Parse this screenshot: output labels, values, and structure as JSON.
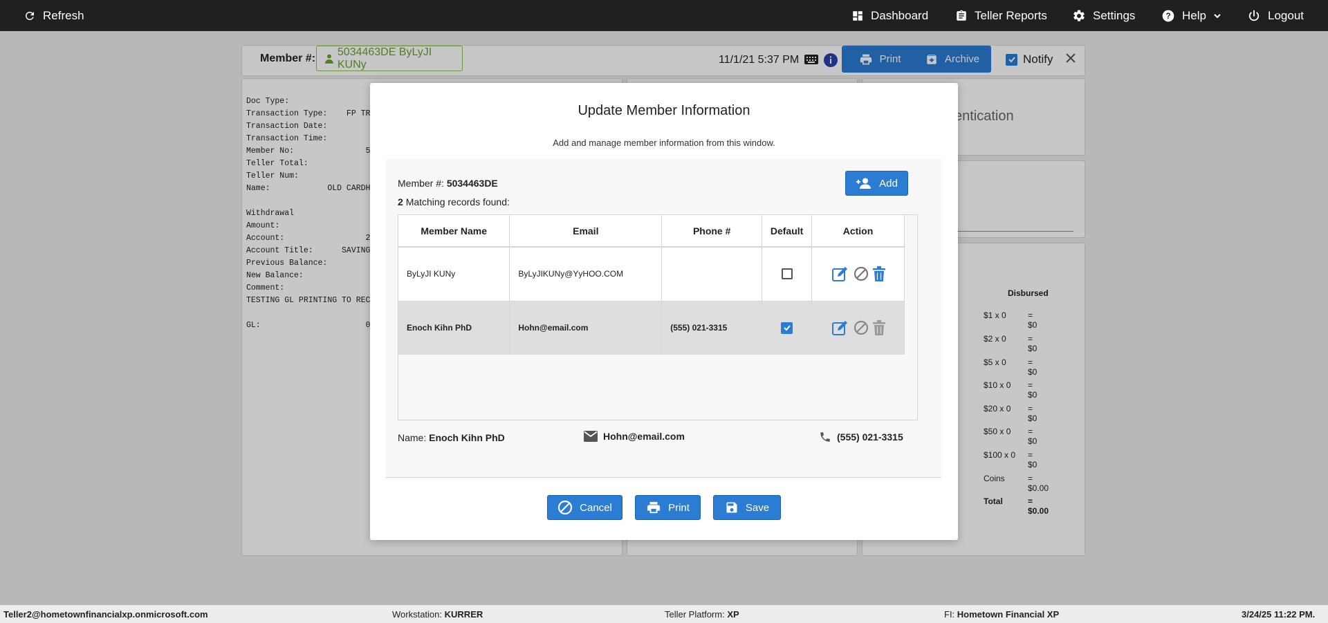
{
  "topnav": {
    "refresh": "Refresh",
    "dashboard": "Dashboard",
    "teller_reports": "Teller Reports",
    "settings": "Settings",
    "help": "Help",
    "logout": "Logout"
  },
  "header": {
    "member_label": "Member #:",
    "member_chip": "5034463DE ByLyJI KUNy",
    "datetime": "11/1/21 5:37 PM",
    "print": "Print",
    "archive": "Archive",
    "notify": "Notify"
  },
  "receipt": {
    "lines": [
      "Doc Type:",
      "Transaction Type:    FP TRA",
      "Transaction Date:",
      "Transaction Time:",
      "Member No:               5",
      "Teller Total:",
      "Teller Num:",
      "Name:            OLD CARDH",
      "",
      "Withdrawal",
      "Amount:",
      "Account:                 2",
      "Account Title:      SAVINGS",
      "Previous Balance:",
      "New Balance:",
      "Comment:",
      "TESTING GL PRINTING TO RECE",
      "",
      "GL:                      0"
    ]
  },
  "auth_panel": {
    "text": "entication"
  },
  "disbursed": {
    "title": "Disbursed",
    "rows": [
      {
        "label": "$1 x 0",
        "value": "= $0"
      },
      {
        "label": "$2 x 0",
        "value": "= $0"
      },
      {
        "label": "$5 x 0",
        "value": "= $0"
      },
      {
        "label": "$10 x 0",
        "value": "= $0"
      },
      {
        "label": "$20 x 0",
        "value": "= $0"
      },
      {
        "label": "$50 x 0",
        "value": "= $0"
      },
      {
        "label": "$100 x 0",
        "value": "= $0"
      },
      {
        "label": "Coins",
        "value": "= $0.00"
      },
      {
        "label": "Total",
        "value": "= $0.00"
      }
    ]
  },
  "modal": {
    "title": "Update Member Information",
    "subtitle": "Add and manage member information from this window.",
    "member_label": "Member #:",
    "member_number": "5034463DE",
    "match_count": "2",
    "match_text": "Matching records found:",
    "add": "Add",
    "columns": [
      "Member Name",
      "Email",
      "Phone #",
      "Default",
      "Action"
    ],
    "rows": [
      {
        "name": "ByLyJI KUNy",
        "email": "ByLyJIKUNy@YyHOO.COM",
        "phone": "",
        "default": false
      },
      {
        "name": "Enoch Kihn PhD",
        "email": "Hohn@email.com",
        "phone": "(555) 021-3315",
        "default": true
      }
    ],
    "summary": {
      "name_label": "Name:",
      "name": "Enoch Kihn PhD",
      "email": "Hohn@email.com",
      "phone": "(555) 021-3315"
    },
    "cancel": "Cancel",
    "print": "Print",
    "save": "Save"
  },
  "status": {
    "user": "Teller2@hometownfinancialxp.onmicrosoft.com",
    "workstation_label": "Workstation:",
    "workstation": "KURRER",
    "platform_label": "Teller Platform:",
    "platform": "XP",
    "fi_label": "FI:",
    "fi": "Hometown Financial XP",
    "datetime": "3/24/25 11:22 PM."
  },
  "colors": {
    "primary": "#2b7cd3",
    "nav_bg": "#202020",
    "member_green": "#6aa22f"
  }
}
